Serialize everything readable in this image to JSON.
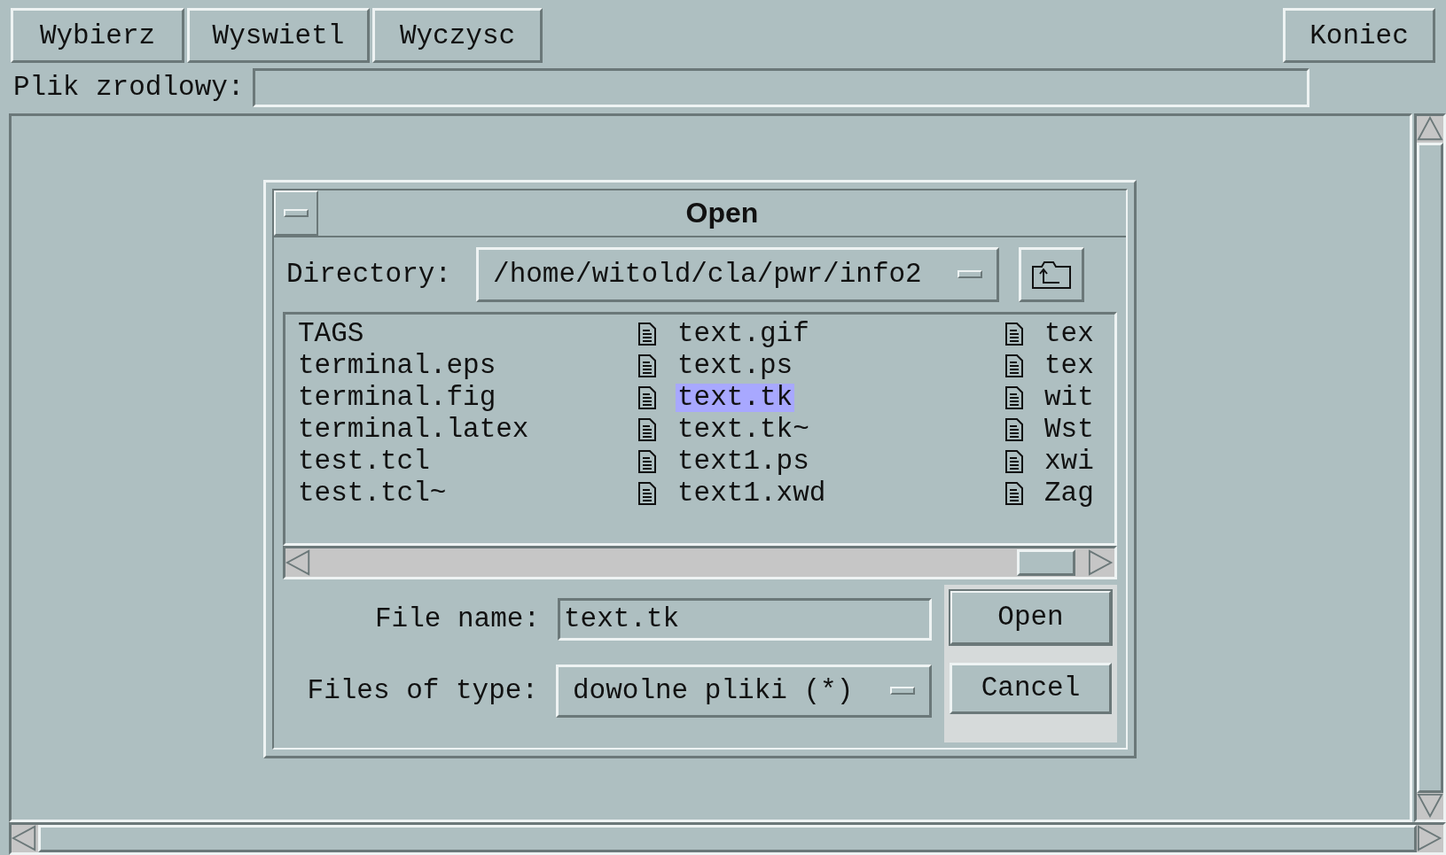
{
  "toolbar": {
    "buttons": [
      {
        "label": "Wybierz"
      },
      {
        "label": "Wyswietl"
      },
      {
        "label": "Wyczysc"
      }
    ],
    "end_button": {
      "label": "Koniec"
    }
  },
  "source_file": {
    "label": "Plik zrodlowy:"
  },
  "dialog": {
    "title": "Open",
    "directory": {
      "label": "Directory:",
      "value": "/home/witold/cla/pwr/info2"
    },
    "file_columns": [
      [
        {
          "name": "TAGS",
          "kind": "plain",
          "selected": false
        },
        {
          "name": "terminal.eps",
          "kind": "plain",
          "selected": false
        },
        {
          "name": "terminal.fig",
          "kind": "plain",
          "selected": false
        },
        {
          "name": "terminal.latex",
          "kind": "plain",
          "selected": false
        },
        {
          "name": "test.tcl",
          "kind": "plain",
          "selected": false
        },
        {
          "name": "test.tcl~",
          "kind": "plain",
          "selected": false
        }
      ],
      [
        {
          "name": "text.gif",
          "kind": "file",
          "selected": false
        },
        {
          "name": "text.ps",
          "kind": "file",
          "selected": false
        },
        {
          "name": "text.tk",
          "kind": "file",
          "selected": true
        },
        {
          "name": "text.tk~",
          "kind": "file",
          "selected": false
        },
        {
          "name": "text1.ps",
          "kind": "file",
          "selected": false
        },
        {
          "name": "text1.xwd",
          "kind": "file",
          "selected": false
        }
      ],
      [
        {
          "name": "tex",
          "kind": "file",
          "selected": false
        },
        {
          "name": "tex",
          "kind": "file",
          "selected": false
        },
        {
          "name": "wit",
          "kind": "file",
          "selected": false
        },
        {
          "name": "Wst",
          "kind": "file",
          "selected": false
        },
        {
          "name": "xwi",
          "kind": "file",
          "selected": false
        },
        {
          "name": "Zag",
          "kind": "file",
          "selected": false
        }
      ]
    ],
    "file_name": {
      "label": "File name:",
      "value": "text.tk"
    },
    "file_type": {
      "label": "Files of type:",
      "value": "dowolne pliki (*)"
    },
    "buttons": [
      {
        "label": "Open",
        "default": true
      },
      {
        "label": "Cancel",
        "default": false
      }
    ]
  }
}
